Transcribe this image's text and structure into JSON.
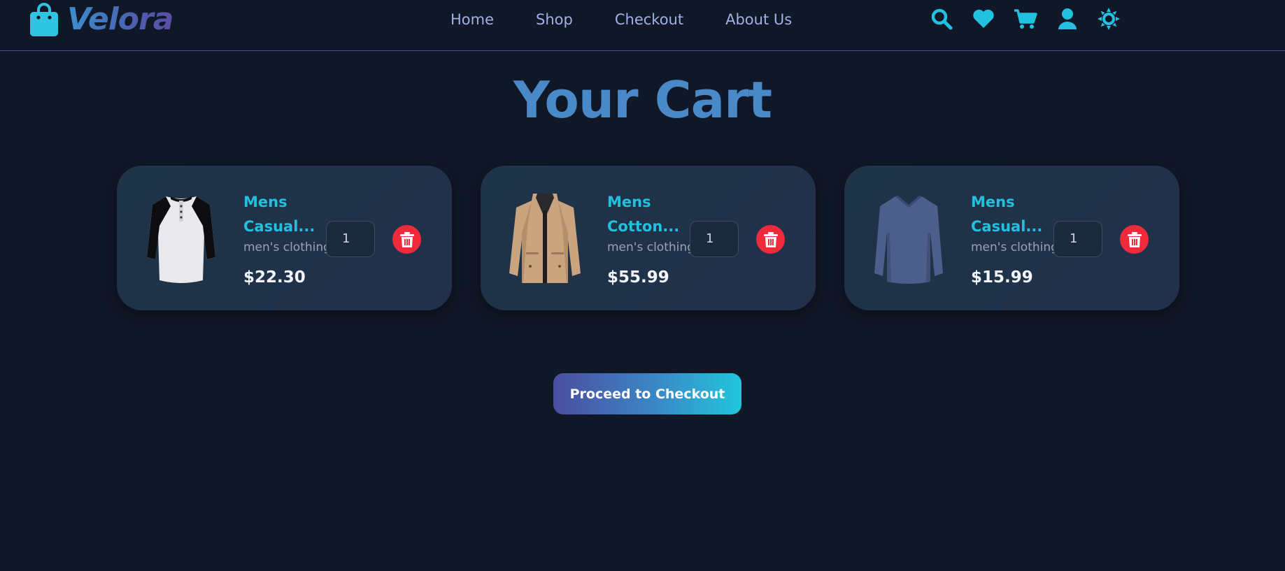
{
  "brand": {
    "name": "Velora",
    "icon": "shopping-bag-icon",
    "colors": {
      "accent": "#22c1e0",
      "title": "#4a89c8",
      "danger": "#ef2b3b"
    }
  },
  "nav": {
    "items": [
      {
        "label": "Home"
      },
      {
        "label": "Shop"
      },
      {
        "label": "Checkout"
      },
      {
        "label": "About Us"
      }
    ]
  },
  "header_icons": [
    "search-icon",
    "heart-icon",
    "cart-icon",
    "user-icon",
    "sun-icon"
  ],
  "page": {
    "title": "Your Cart"
  },
  "cart": {
    "items": [
      {
        "name_line1": "Mens",
        "name_line2": "Casual...",
        "category": "men's clothing",
        "price": "$22.30",
        "quantity": "1",
        "image": "raglan-henley-shirt"
      },
      {
        "name_line1": "Mens",
        "name_line2": "Cotton...",
        "category": "men's clothing",
        "price": "$55.99",
        "quantity": "1",
        "image": "cotton-jacket"
      },
      {
        "name_line1": "Mens",
        "name_line2": "Casual...",
        "category": "men's clothing",
        "price": "$15.99",
        "quantity": "1",
        "image": "long-sleeve-vneck-shirt"
      }
    ]
  },
  "checkout": {
    "label": "Proceed to Checkout"
  }
}
